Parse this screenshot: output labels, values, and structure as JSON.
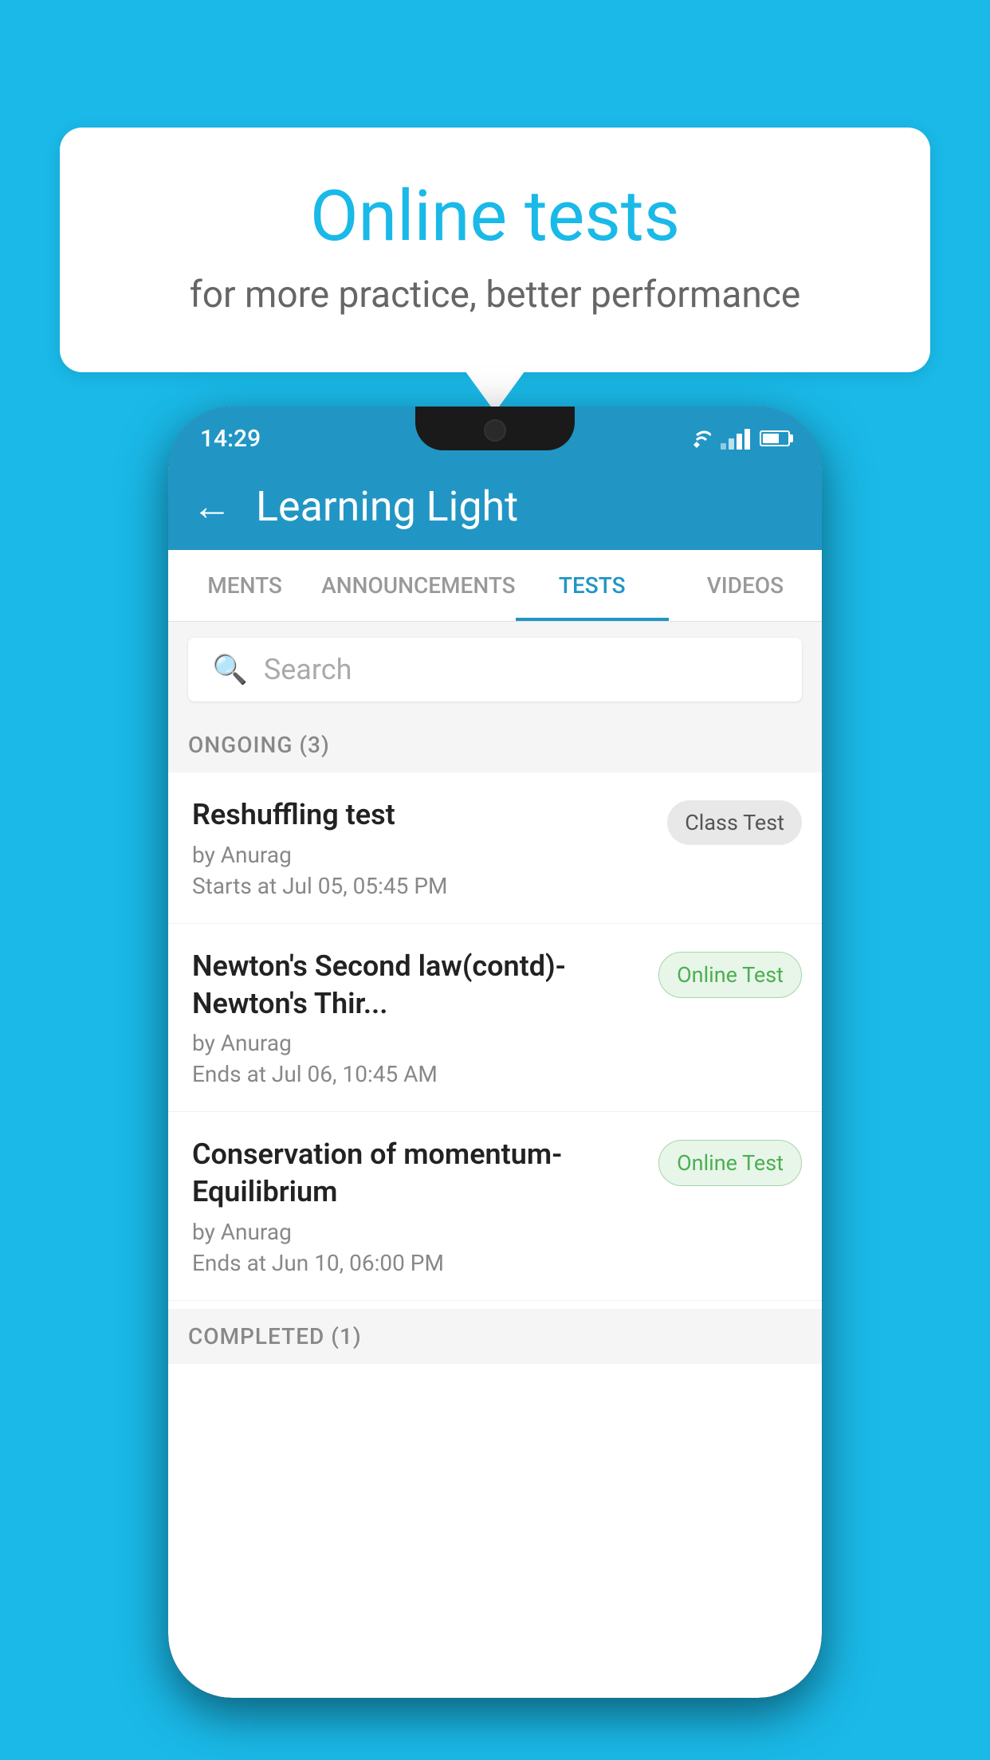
{
  "background_color": "#1ab9e8",
  "bubble": {
    "title": "Online tests",
    "subtitle": "for more practice, better performance"
  },
  "phone": {
    "status_bar": {
      "time": "14:29"
    },
    "app_bar": {
      "title": "Learning Light"
    },
    "tabs": [
      {
        "label": "MENTS",
        "active": false
      },
      {
        "label": "ANNOUNCEMENTS",
        "active": false
      },
      {
        "label": "TESTS",
        "active": true
      },
      {
        "label": "VIDEOS",
        "active": false
      }
    ],
    "search": {
      "placeholder": "Search"
    },
    "ongoing_section": {
      "title": "ONGOING (3)"
    },
    "tests": [
      {
        "name": "Reshuffling test",
        "by": "by Anurag",
        "date": "Starts at  Jul 05, 05:45 PM",
        "badge": "Class Test",
        "badge_type": "class"
      },
      {
        "name": "Newton's Second law(contd)-Newton's Thir...",
        "by": "by Anurag",
        "date": "Ends at  Jul 06, 10:45 AM",
        "badge": "Online Test",
        "badge_type": "online"
      },
      {
        "name": "Conservation of momentum-Equilibrium",
        "by": "by Anurag",
        "date": "Ends at  Jun 10, 06:00 PM",
        "badge": "Online Test",
        "badge_type": "online"
      }
    ],
    "completed_section": {
      "title": "COMPLETED (1)"
    }
  }
}
